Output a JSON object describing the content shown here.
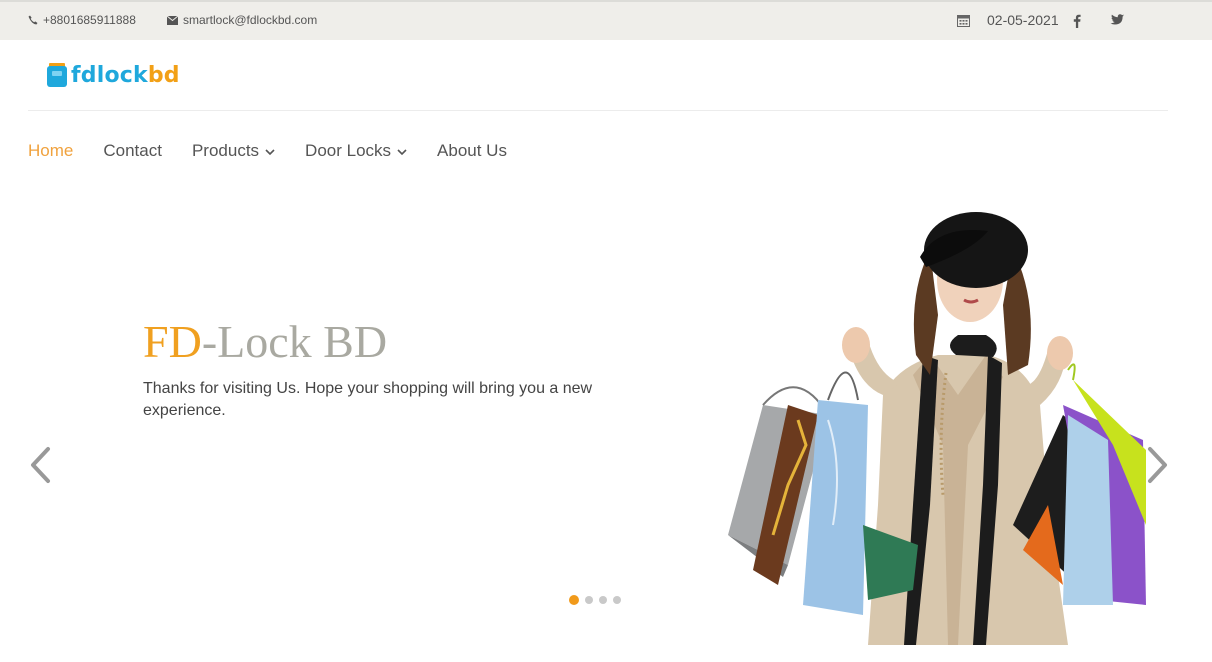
{
  "topbar": {
    "phone": "+8801685911888",
    "email": "smartlock@fdlockbd.com",
    "date": "02-05-2021",
    "icons": [
      "phone-icon",
      "envelope-icon",
      "calendar-icon",
      "facebook-icon",
      "twitter-icon"
    ]
  },
  "logo": {
    "part1": "fdlock",
    "part2": "bd"
  },
  "nav": {
    "items": [
      {
        "label": "Home",
        "active": true
      },
      {
        "label": "Contact"
      },
      {
        "label": "Products",
        "dropdown": true
      },
      {
        "label": "Door Locks",
        "dropdown": true
      },
      {
        "label": "About Us"
      }
    ]
  },
  "hero": {
    "title_accent": "FD",
    "title_rest": "-Lock BD",
    "subtitle": "Thanks for visiting Us. Hope your shopping will bring you a new experience.",
    "slide_count": 4,
    "active_slide": 1
  },
  "colors": {
    "accent": "#f0a020",
    "topbar_bg": "#efeeea",
    "logo_blue": "#1fa8dc",
    "logo_orange": "#f2a016"
  }
}
